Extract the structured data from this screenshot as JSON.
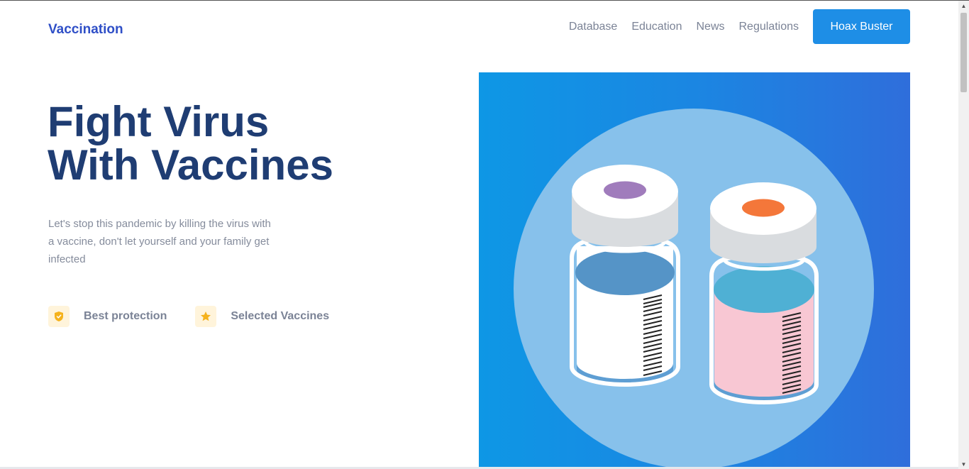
{
  "brand": {
    "name": "Vaccination"
  },
  "nav": {
    "links": [
      "Database",
      "Education",
      "News",
      "Regulations"
    ],
    "cta_label": "Hoax Buster"
  },
  "hero": {
    "title_lines": [
      "Fight Virus",
      "With Vaccines"
    ],
    "subtitle": "Let's stop this pandemic by killing the virus with a vaccine, don't let yourself and your family get infected",
    "features": [
      {
        "icon": "shield-icon",
        "label": "Best protection"
      },
      {
        "icon": "star-icon",
        "label": "Selected Vaccines"
      }
    ]
  },
  "colors": {
    "brand": "#2f4fc7",
    "title": "#1f3d73",
    "cta": "#1e8ee6",
    "hero_gradient_start": "#0e97e5",
    "hero_gradient_end": "#2f6edb"
  }
}
